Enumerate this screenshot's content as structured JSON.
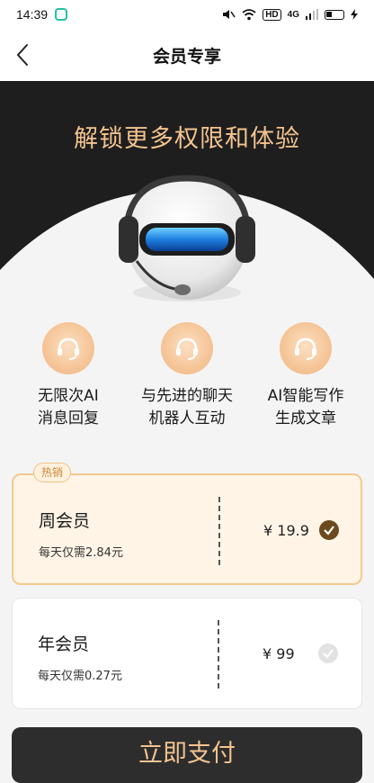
{
  "status_bar": {
    "time": "14:39",
    "net_label": "HD",
    "signal_label": "4G"
  },
  "nav": {
    "title": "会员专享"
  },
  "hero": {
    "title": "解锁更多权限和体验"
  },
  "features": [
    {
      "line1": "无限次AI",
      "line2": "消息回复"
    },
    {
      "line1": "与先进的聊天",
      "line2": "机器人互动"
    },
    {
      "line1": "AI智能写作",
      "line2": "生成文章"
    }
  ],
  "plans": {
    "weekly": {
      "badge": "热销",
      "name": "周会员",
      "daily": "每天仅需2.84元",
      "price": "¥ 19.9",
      "selected": true
    },
    "yearly": {
      "name": "年会员",
      "daily": "每天仅需0.27元",
      "price": "¥ 99",
      "selected": false
    }
  },
  "pay_button": "立即支付",
  "colors": {
    "accent_gold": "#f3c38f",
    "hero_dark": "#1e1e1e",
    "selected_check": "#6b4a1f"
  },
  "icons": {
    "back": "chevron-left-icon",
    "feature": "headset-icon",
    "check": "check-icon"
  }
}
